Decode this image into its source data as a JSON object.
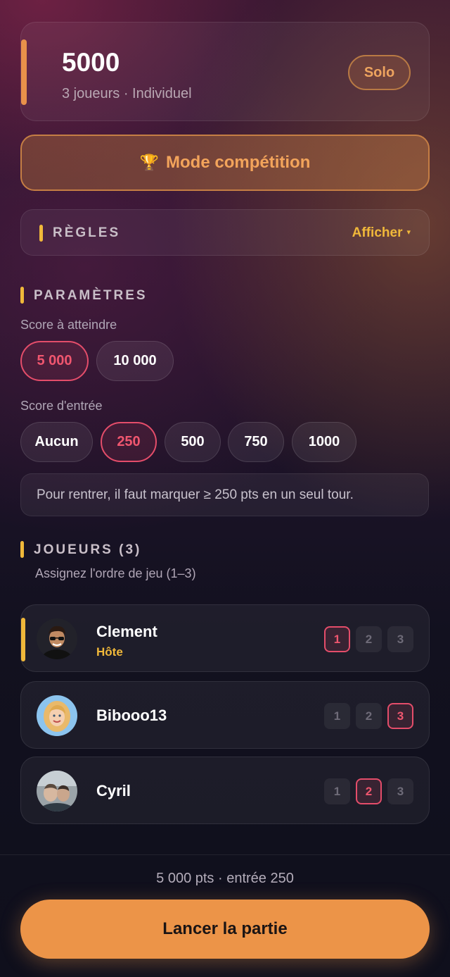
{
  "header": {
    "title": "5000",
    "subtitle": "3 joueurs · Individuel",
    "badge": "Solo"
  },
  "competition": {
    "icon": "trophy-icon",
    "label": "Mode compétition"
  },
  "rules": {
    "title": "RÈGLES",
    "toggle_label": "Afficher",
    "toggle_caret": "▾"
  },
  "parameters": {
    "title": "PARAMÈTRES",
    "target_label": "Score à atteindre",
    "target_options": [
      "5 000",
      "10 000"
    ],
    "target_selected": "5 000",
    "entry_label": "Score d'entrée",
    "entry_options": [
      "Aucun",
      "250",
      "500",
      "750",
      "1000"
    ],
    "entry_selected": "250",
    "entry_note": "Pour rentrer, il faut marquer ≥ 250 pts en un seul tour."
  },
  "players": {
    "title": "JOUEURS (3)",
    "subtitle": "Assignez l'ordre de jeu (1–3)",
    "order_labels": [
      "1",
      "2",
      "3"
    ],
    "list": [
      {
        "name": "Clement",
        "role": "Hôte",
        "order": "1"
      },
      {
        "name": "Bibooo13",
        "role": "",
        "order": "3"
      },
      {
        "name": "Cyril",
        "role": "",
        "order": "2"
      }
    ]
  },
  "footer": {
    "summary": "5 000 pts · entrée 250",
    "launch_label": "Lancer la partie"
  },
  "colors": {
    "accent_orange": "#ec9448",
    "accent_yellow": "#f0b83a",
    "selected_pink": "#e44d6a"
  }
}
